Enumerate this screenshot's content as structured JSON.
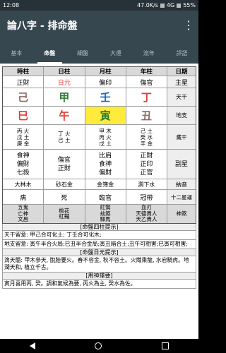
{
  "status": {
    "time": "12:08",
    "net": "47.0K/s",
    "signal": "4G",
    "battery": "55%"
  },
  "app": {
    "title": "論八字 - 排命盤"
  },
  "tabs": [
    "基本",
    "命盤",
    "細盤",
    "大運",
    "流年",
    "評語"
  ],
  "active_tab_index": 1,
  "chart": {
    "headers": [
      "時柱",
      "日柱",
      "月柱",
      "年柱",
      "日期"
    ],
    "shishen": [
      "正財",
      "日元",
      "偏印",
      "傷官"
    ],
    "shishen_label": "主星",
    "stems": [
      "己",
      "甲",
      "壬",
      "丁"
    ],
    "stems_label": "天干",
    "branches": [
      "巳",
      "午",
      "寅",
      "丑"
    ],
    "branches_label": "地支",
    "hidden": [
      [
        "丙 火",
        "戊 土",
        "庚 金"
      ],
      [
        "丁 火",
        "己 土"
      ],
      [
        "甲 木",
        "丙 火",
        "戊 土"
      ],
      [
        "己 土",
        "癸 水",
        "辛 金"
      ]
    ],
    "hidden_label": "藏干",
    "sub": [
      [
        "食神",
        "偏財",
        "七殺"
      ],
      [
        "傷官",
        "正財"
      ],
      [
        "比肩",
        "食神",
        "偏財"
      ],
      [
        "正財",
        "正印",
        "正官"
      ]
    ],
    "sub_label": "副星",
    "nayin": [
      "大林木",
      "砂石金",
      "金簿金",
      "澗下水"
    ],
    "nayin_label": "納音",
    "state": [
      "病",
      "死",
      "臨官",
      "冠帶"
    ],
    "state_label": "十二星運",
    "shensha": [
      [
        "五鬼",
        "亡神",
        "文昌"
      ],
      [
        "桃花",
        "紅豔"
      ],
      [
        "紅鸞",
        "劫煞",
        "驛馬"
      ],
      [
        "血刃",
        "天德貴人",
        "天乙貴人"
      ]
    ],
    "shensha_label": "神煞"
  },
  "sections": {
    "pillars_title": "[命盤四柱提示]",
    "tiangan_text": "天干留意: 甲己合可化土; 丁壬合可化木;",
    "dizhi_text": "地支留意: 寅午半合火局;巳丑半合金局;寅丑暗合土;丑午可相害;巳寅可相害;",
    "daymaster_title": "[命盤日元提示]",
    "daymaster_text": "滴天髓: 甲木參天, 脫胎要火。春不容金, 秋不容土。火熾乘龍, 水宕騎虎。地潤天和, 植立千古。",
    "yongshen_title": "[用神擇要]",
    "yongshen_text": "寅月喜用丙, 癸。調和氣候為要, 丙火為主, 癸水為佐。"
  }
}
